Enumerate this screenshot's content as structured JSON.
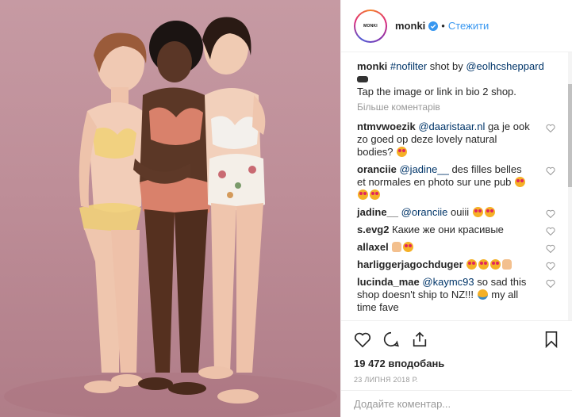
{
  "header": {
    "avatar_text": "MONKI",
    "username": "monki",
    "separator": "•",
    "follow_label": "Стежити"
  },
  "caption": {
    "username": "monki",
    "hashtag": "#nofilter",
    "text1": " shot by ",
    "mention": "@eolhcsheppard",
    "line2": "Tap the image or link in bio 2 shop."
  },
  "more_comments_label": "Більше коментарів",
  "comments": [
    {
      "username": "ntmvwoezik",
      "mention": "@daaristaar.nl",
      "text": " ga je ook zo goed op deze lovely natural bodies? "
    },
    {
      "username": "oranciie",
      "mention": "@jadine__",
      "text": " des filles belles et normales en photo sur une pub "
    },
    {
      "username": "jadine__",
      "mention": "@oranciie",
      "text": " ouiii "
    },
    {
      "username": "s.evg2",
      "mention": "",
      "text": " Какие же они красивые"
    },
    {
      "username": "allaxel",
      "mention": "",
      "text": " "
    },
    {
      "username": "harliggerjagochduger",
      "mention": "",
      "text": " "
    },
    {
      "username": "lucinda_mae",
      "mention": "@kaymc93",
      "text": " so sad this shop doesn't ship to NZ!!! ",
      "tail": " my all time fave"
    }
  ],
  "likes_text": "19 472 вподобань",
  "date_text": "23 ЛИПНЯ 2018 Р.",
  "add_comment_placeholder": "Додайте коментар...",
  "colors": {
    "link": "#003569",
    "follow": "#3897f0",
    "muted": "#999999",
    "photo_bg": "#c69aa3"
  },
  "icons": [
    "verified-icon",
    "heart-icon",
    "comment-icon",
    "share-icon",
    "bookmark-icon"
  ]
}
